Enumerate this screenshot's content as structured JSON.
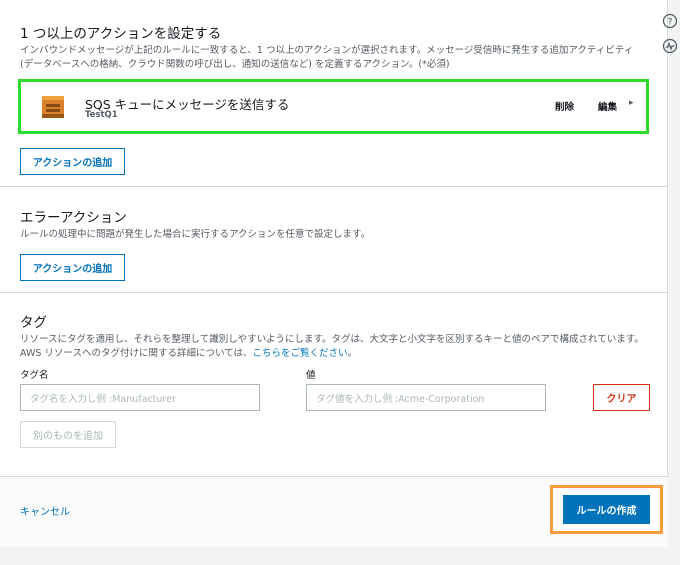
{
  "actions_section": {
    "title": "1 つ以上のアクションを設定する",
    "description_line1": "インバウンドメッセージが上記のルールに一致すると、1 つ以上のアクションが選択されます。メッセージ受信時に発生する追加アクティビティ",
    "description_line2": "(データベースへの格納、クラウド関数の呼び出し、通知の送信など) を定義するアクション。(*必須)",
    "action": {
      "icon": "sqs-icon",
      "title": "SQS キューにメッセージを送信する",
      "subtitle": "TestQ1",
      "delete_label": "削除",
      "edit_label": "編集",
      "chevron": "▸"
    },
    "add_button": "アクションの追加"
  },
  "error_section": {
    "title": "エラーアクション",
    "description": "ルールの処理中に問題が発生した場合に実行するアクションを任意で設定します。",
    "add_button": "アクションの追加"
  },
  "tags_section": {
    "title": "タグ",
    "description_line1": "リソースにタグを適用し、それらを整理して識別しやすいようにします。タグは、大文字と小文字を区別するキーと値のペアで構成されています。",
    "description_line2_prefix": "AWS リソースへのタグ付けに関する詳細については、",
    "description_link": "こちらをご覧ください",
    "description_line2_suffix": "。",
    "tag_name_label": "タグ名",
    "tag_name_placeholder": "タグ名を入力し例 :Manufacturer",
    "value_label": "値",
    "value_placeholder": "タグ値を入力し例 :Acme-Corporation",
    "clear_button": "クリア",
    "add_another_button": "別のものを追加"
  },
  "footer": {
    "cancel_label": "キャンセル",
    "create_label": "ルールの作成"
  },
  "rail": {
    "help_icon": "?",
    "activity_icon": "~"
  },
  "colors": {
    "accent": "#0073bb",
    "highlight_green": "#2bdc2b",
    "highlight_orange": "#f89c3c",
    "danger": "#d13212"
  }
}
